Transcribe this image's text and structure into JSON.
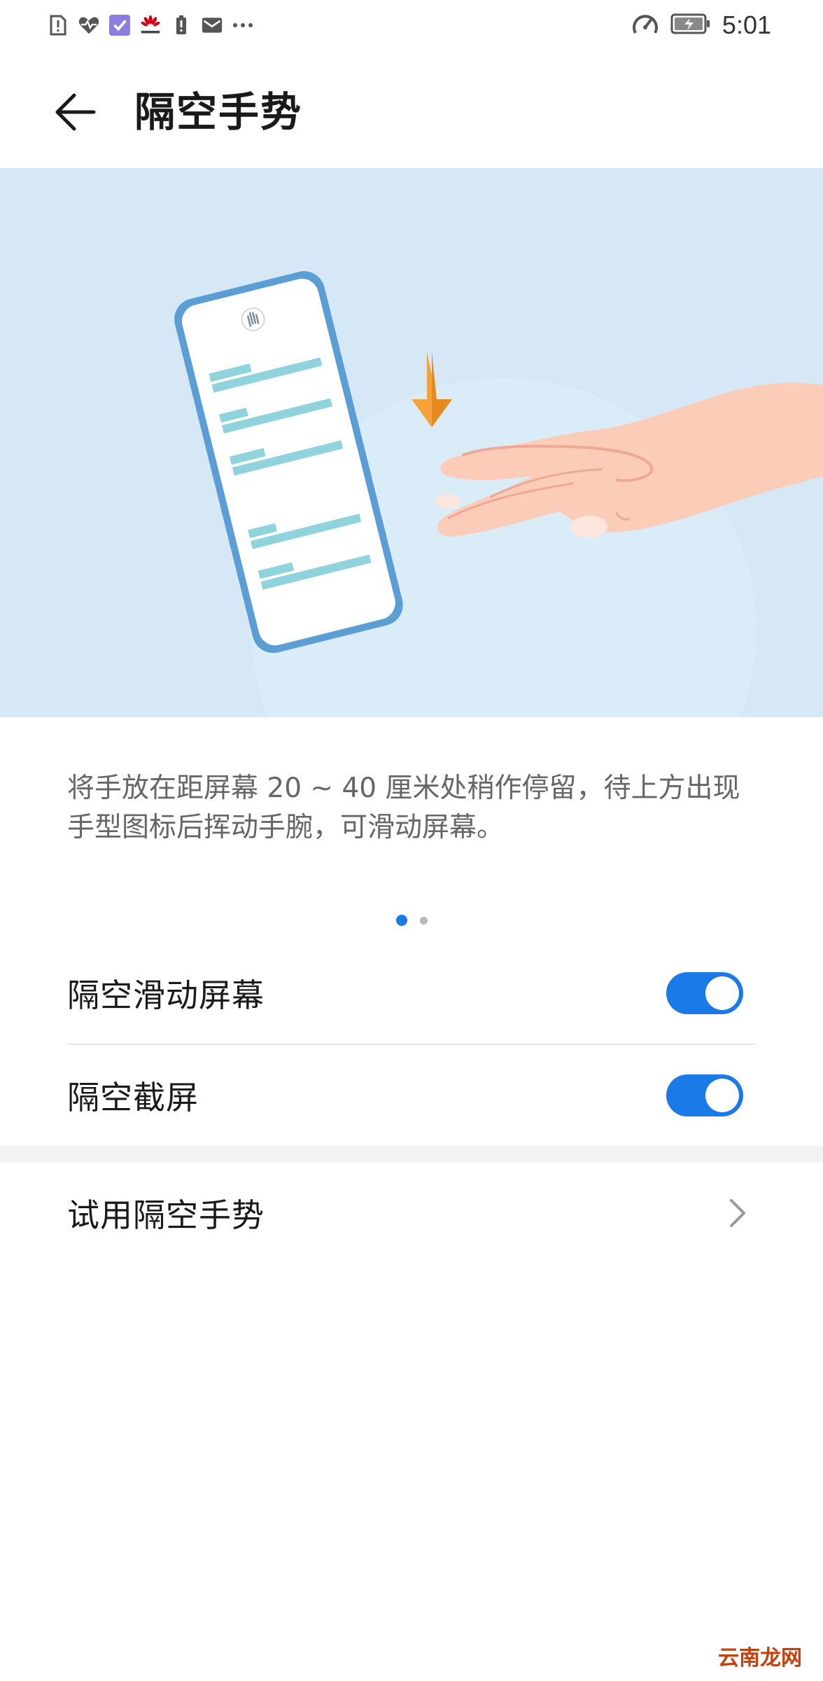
{
  "status_bar": {
    "time": "5:01",
    "left_icons": [
      "alert-sim-icon",
      "health-heart-icon",
      "checklist-app-icon",
      "huawei-logo-icon",
      "battery-small-icon",
      "mail-icon",
      "more-dots-icon"
    ],
    "right_icons": [
      "speed-gauge-icon",
      "battery-charging-icon"
    ]
  },
  "header": {
    "title": "隔空手势"
  },
  "illustration": {
    "colors": {
      "background": "#d6e8f5",
      "phone_frame": "#5b9ed6",
      "text_lines": "#8fd3dc",
      "arrow": "#f5a23b",
      "hand": "#fbcdb8"
    }
  },
  "description": "将手放在距屏幕 20 ~ 40 厘米处稍作停留，待上方出现手型图标后挥动手腕，可滑动屏幕。",
  "pager": {
    "count": 2,
    "active": 1
  },
  "settings": [
    {
      "label": "隔空滑动屏幕",
      "enabled": true
    },
    {
      "label": "隔空截屏",
      "enabled": true
    }
  ],
  "try_row": {
    "label": "试用隔空手势"
  },
  "watermark": "云南龙网",
  "accent_color": "#1a7ae8"
}
